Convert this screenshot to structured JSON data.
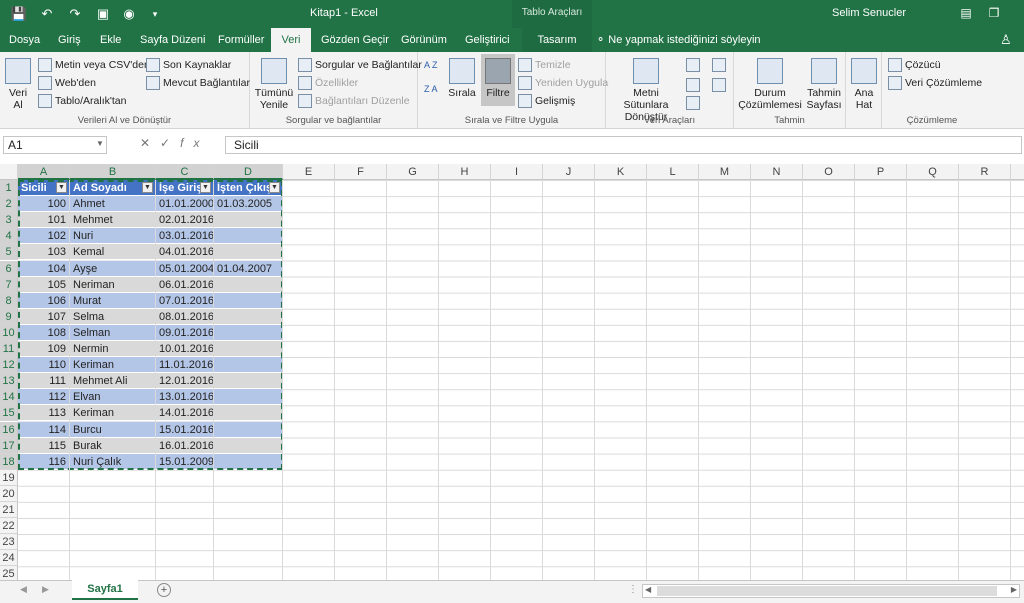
{
  "titlebar": {
    "title": "Kitap1  -  Excel",
    "context": "Tablo Araçları",
    "user": "Selim Senucler"
  },
  "tabs": [
    "Dosya",
    "Giriş",
    "Ekle",
    "Sayfa Düzeni",
    "Formüller",
    "Veri",
    "Gözden Geçir",
    "Görünüm",
    "Geliştirici",
    "Tasarım"
  ],
  "tellme": "Ne yapmak istediğinizi söyleyin",
  "ribbon": {
    "get": {
      "big": "Veri Al",
      "items": [
        "Metin veya CSV'den",
        "Web'den",
        "Tablo/Aralık'tan"
      ],
      "label": "Verileri Al ve Dönüştür"
    },
    "recent": [
      "Son Kaynaklar",
      "Mevcut Bağlantılar"
    ],
    "queries": {
      "big": "Tümünü Yenile",
      "items": [
        "Sorgular ve Bağlantılar",
        "Özellikler",
        "Bağlantıları Düzenle"
      ],
      "label": "Sorgular ve bağlantılar"
    },
    "sort": {
      "az": "A Z",
      "za": "Z A",
      "sort": "Sırala",
      "filter": "Filtre",
      "clear": "Temizle",
      "reapply": "Yeniden Uygula",
      "advanced": "Gelişmiş",
      "label": "Sırala ve Filtre Uygula"
    },
    "tools": {
      "big": "Metni Sütunlara Dönüştür",
      "label": "Veri Araçları"
    },
    "forecast": {
      "whatif": "Durum Çözümlemesi",
      "sheet": "Tahmin Sayfası",
      "label": "Tahmin"
    },
    "outline": "Ana Hat",
    "analysis": {
      "items": [
        "Çözücü",
        "Veri Çözümleme"
      ],
      "label": "Çözümleme"
    }
  },
  "namebox": "A1",
  "formula": "Sicili",
  "columns": [
    "A",
    "B",
    "C",
    "D",
    "E",
    "F",
    "G",
    "H",
    "I",
    "J",
    "K",
    "L",
    "M",
    "N",
    "O",
    "P",
    "Q",
    "R"
  ],
  "headers": [
    "Sicili",
    "Ad Soyadı",
    "İşe Giriş",
    "İşten Çıkış"
  ],
  "rows": [
    [
      "100",
      "Ahmet",
      "01.01.2000",
      "01.03.2005"
    ],
    [
      "101",
      "Mehmet",
      "02.01.2016",
      ""
    ],
    [
      "102",
      "Nuri",
      "03.01.2016",
      ""
    ],
    [
      "103",
      "Kemal",
      "04.01.2016",
      ""
    ],
    [
      "104",
      "Ayşe",
      "05.01.2004",
      "01.04.2007"
    ],
    [
      "105",
      "Neriman",
      "06.01.2016",
      ""
    ],
    [
      "106",
      "Murat",
      "07.01.2016",
      ""
    ],
    [
      "107",
      "Selma",
      "08.01.2016",
      ""
    ],
    [
      "108",
      "Selman",
      "09.01.2016",
      ""
    ],
    [
      "109",
      "Nermin",
      "10.01.2016",
      ""
    ],
    [
      "110",
      "Keriman",
      "11.01.2016",
      ""
    ],
    [
      "111",
      "Mehmet Ali",
      "12.01.2016",
      ""
    ],
    [
      "112",
      "Elvan",
      "13.01.2016",
      ""
    ],
    [
      "113",
      "Keriman",
      "14.01.2016",
      ""
    ],
    [
      "114",
      "Burcu",
      "15.01.2016",
      ""
    ],
    [
      "115",
      "Burak",
      "16.01.2016",
      ""
    ],
    [
      "116",
      "Nuri Çalık",
      "15.01.2009",
      ""
    ]
  ],
  "sheet": "Sayfa1",
  "colors": {
    "accent": "#217346",
    "tableHeader": "#4472c4",
    "band1": "#b4c6e7",
    "band2": "#d9d9d9"
  }
}
